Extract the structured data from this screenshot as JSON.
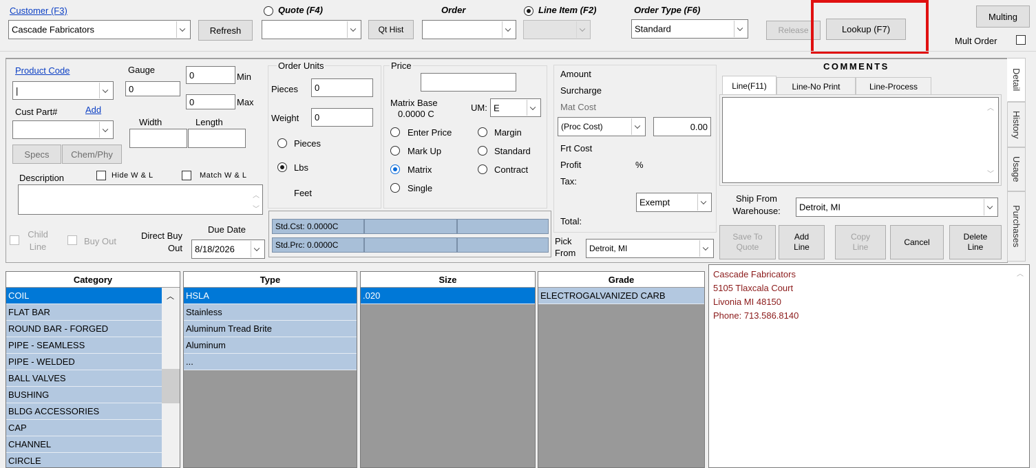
{
  "header": {
    "customer_link": "Customer (F3)",
    "customer_value": "Cascade Fabricators",
    "refresh": "Refresh",
    "quote_label": "Quote (F4)",
    "qt_hist": "Qt Hist",
    "order_label": "Order",
    "line_item_label": "Line Item (F2)",
    "order_type_label": "Order Type (F6)",
    "order_type_value": "Standard",
    "release": "Release",
    "lookup": "Lookup (F7)",
    "multing": "Multing",
    "mult_order": "Mult Order"
  },
  "product": {
    "product_code": "Product Code",
    "product_code_value": "|",
    "gauge": "Gauge",
    "gauge_value": "0",
    "min_value": "0",
    "min_label": "Min",
    "max_value": "0",
    "max_label": "Max",
    "cust_part": "Cust Part#",
    "add_link": "Add",
    "width": "Width",
    "length": "Length",
    "specs": "Specs",
    "chem_phy": "Chem/Phy",
    "description": "Description",
    "hide_wl": "Hide W & L",
    "match_wl": "Match W & L",
    "child_line": "Child Line",
    "buy_out": "Buy Out",
    "direct_buy_out": "Direct Buy Out",
    "due_date": "Due Date",
    "due_date_value": "8/18/2026"
  },
  "order_units": {
    "title": "Order Units",
    "pieces": "Pieces",
    "pieces_value": "0",
    "weight": "Weight",
    "weight_value": "0",
    "opt_pieces": "Pieces",
    "opt_lbs": "Lbs",
    "feet": "Feet"
  },
  "price": {
    "title": "Price",
    "matrix_base": "Matrix Base",
    "matrix_base_value": "0.0000 C",
    "um": "UM:",
    "um_value": "E",
    "enter_price": "Enter Price",
    "margin": "Margin",
    "mark_up": "Mark Up",
    "standard": "Standard",
    "matrix": "Matrix",
    "contract": "Contract",
    "single": "Single"
  },
  "std": {
    "cost": "Std.Cst: 0.0000C",
    "price": "Std.Prc: 0.0000C"
  },
  "amount": {
    "amount": "Amount",
    "surcharge": "Surcharge",
    "mat_cost": "Mat Cost",
    "proc_cost": "(Proc Cost)",
    "proc_value": "0.00",
    "frt_cost": "Frt Cost",
    "profit": "Profit",
    "percent": "%",
    "tax": "Tax:",
    "exempt": "Exempt",
    "total": "Total:",
    "pick_from": "Pick From",
    "pick_from_value": "Detroit, MI"
  },
  "comments": {
    "title": "COMMENTS",
    "tabs": [
      "Line(F11)",
      "Line-No Print",
      "Line-Process"
    ],
    "ship_from": "Ship From Warehouse:",
    "ship_from_value": "Detroit, MI"
  },
  "actions": {
    "save_to_quote": "Save To Quote",
    "add_line": "Add Line",
    "copy_line": "Copy Line",
    "cancel": "Cancel",
    "delete_line": "Delete Line"
  },
  "side_tabs": [
    "Detail",
    "History",
    "Usage",
    "Purchases"
  ],
  "lists": {
    "category": {
      "header": "Category",
      "rows": [
        "COIL",
        "FLAT BAR",
        "ROUND BAR - FORGED",
        "PIPE - SEAMLESS",
        "PIPE - WELDED",
        "BALL VALVES",
        "BUSHING",
        "BLDG ACCESSORIES",
        "CAP",
        "CHANNEL",
        "CIRCLE"
      ]
    },
    "type": {
      "header": "Type",
      "rows": [
        "HSLA",
        "Stainless",
        "Aluminum Tread Brite",
        "Aluminum",
        "..."
      ]
    },
    "size": {
      "header": "Size",
      "rows": [
        ".020"
      ]
    },
    "grade": {
      "header": "Grade",
      "rows": [
        "ELECTROGALVANIZED CARB"
      ]
    }
  },
  "address": {
    "name": "Cascade Fabricators",
    "street": "5105 Tlaxcala Court",
    "city": "Livonia MI 48150",
    "phone": "Phone: 713.586.8140"
  },
  "colors": {
    "highlight_box": "#e01010",
    "selected_row": "#0078d7",
    "list_row": "#b3c8e0",
    "address_text": "#8b1a1a"
  }
}
